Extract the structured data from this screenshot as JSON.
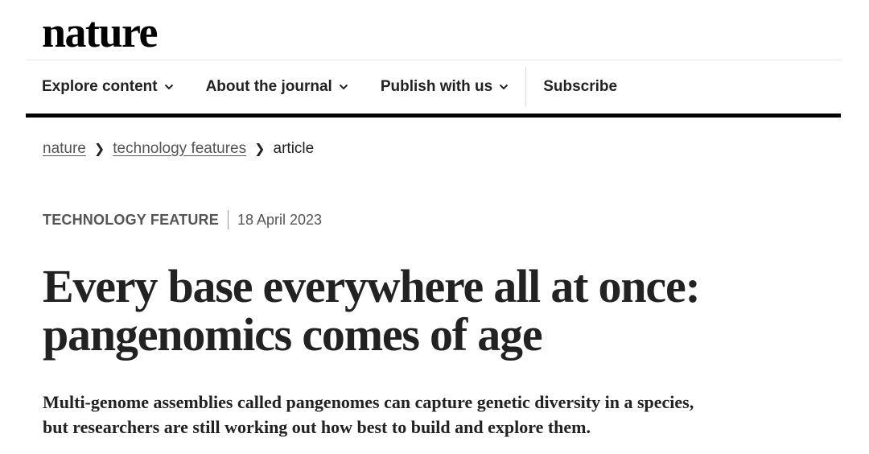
{
  "site": {
    "logo": "nature"
  },
  "nav": {
    "items": [
      {
        "label": "Explore content",
        "icon": "chevron-down-icon"
      },
      {
        "label": "About the journal",
        "icon": "chevron-down-icon"
      },
      {
        "label": "Publish with us",
        "icon": "chevron-down-icon"
      }
    ],
    "subscribe": "Subscribe"
  },
  "breadcrumb": {
    "items": [
      "nature",
      "technology features",
      "article"
    ]
  },
  "article": {
    "type": "TECHNOLOGY FEATURE",
    "date": "18 April 2023",
    "title_line1": "Every base everywhere all at once:",
    "title_line2": "pangenomics comes of age",
    "standfirst_line1": "Multi-genome assemblies called pangenomes can capture genetic diversity in a species,",
    "standfirst_line2": "but researchers are still working out how best to build and explore them."
  },
  "colors": {
    "text": "#222222",
    "muted": "#555555",
    "rule": "#000000"
  }
}
